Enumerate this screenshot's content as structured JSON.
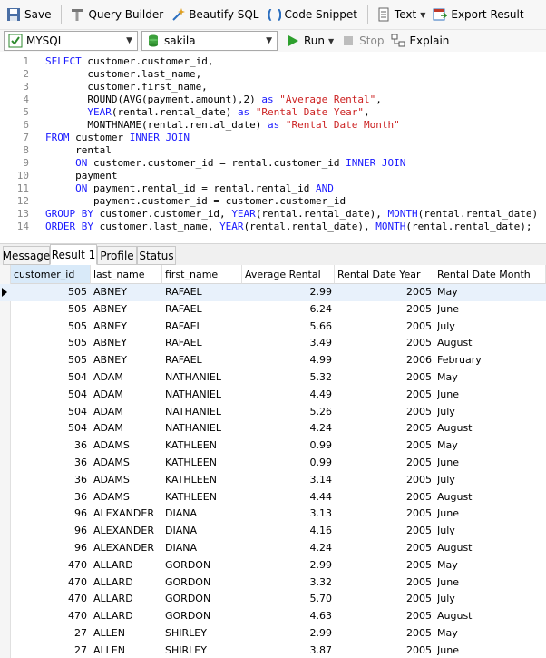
{
  "toolbar": {
    "save": "Save",
    "query_builder": "Query Builder",
    "beautify": "Beautify SQL",
    "code_snippet": "Code Snippet",
    "text": "Text",
    "export": "Export Result",
    "connection": "MYSQL",
    "database": "sakila",
    "run": "Run",
    "stop": "Stop",
    "explain": "Explain"
  },
  "editor": {
    "lines": [
      {
        "n": "1"
      },
      {
        "n": "2"
      },
      {
        "n": "3"
      },
      {
        "n": "4"
      },
      {
        "n": "5"
      },
      {
        "n": "6"
      },
      {
        "n": "7"
      },
      {
        "n": "8"
      },
      {
        "n": "9"
      },
      {
        "n": "10"
      },
      {
        "n": "11"
      },
      {
        "n": "12"
      },
      {
        "n": "13"
      },
      {
        "n": "14"
      }
    ],
    "t": {
      "l1a": "SELECT",
      "l1b": " customer.customer_id,",
      "l2": "       customer.last_name,",
      "l3": "       customer.first_name,",
      "l4a": "       ROUND(AVG(payment.amount),2) ",
      "l4b": "as",
      "l4c": " ",
      "l4d": "\"Average Rental\"",
      "l4e": ",",
      "l5a": "       ",
      "l5b": "YEAR",
      "l5c": "(rental.rental_date) ",
      "l5d": "as",
      "l5e": " ",
      "l5f": "\"Rental Date Year\"",
      "l5g": ",",
      "l6a": "       MONTHNAME(rental.rental_date) ",
      "l6b": "as",
      "l6c": " ",
      "l6d": "\"Rental Date Month\"",
      "l7a": "FROM",
      "l7b": " customer ",
      "l7c": "INNER JOIN",
      "l8": "     rental",
      "l9a": "     ",
      "l9b": "ON",
      "l9c": " customer.customer_id = rental.customer_id ",
      "l9d": "INNER JOIN",
      "l10": "     payment",
      "l11a": "     ",
      "l11b": "ON",
      "l11c": " payment.rental_id = rental.rental_id ",
      "l11d": "AND",
      "l12": "        payment.customer_id = customer.customer_id",
      "l13a": "GROUP BY",
      "l13b": " customer.customer_id, ",
      "l13c": "YEAR",
      "l13d": "(rental.rental_date), ",
      "l13e": "MONTH",
      "l13f": "(rental.rental_date)",
      "l14a": "ORDER BY",
      "l14b": " customer.last_name, ",
      "l14c": "YEAR",
      "l14d": "(rental.rental_date), ",
      "l14e": "MONTH",
      "l14f": "(rental.rental_date);"
    }
  },
  "tabs": [
    "Message",
    "Result 1",
    "Profile",
    "Status"
  ],
  "columns": [
    "customer_id",
    "last_name",
    "first_name",
    "Average Rental",
    "Rental Date Year",
    "Rental Date Month"
  ],
  "rows": [
    [
      "505",
      "ABNEY",
      "RAFAEL",
      "2.99",
      "2005",
      "May"
    ],
    [
      "505",
      "ABNEY",
      "RAFAEL",
      "6.24",
      "2005",
      "June"
    ],
    [
      "505",
      "ABNEY",
      "RAFAEL",
      "5.66",
      "2005",
      "July"
    ],
    [
      "505",
      "ABNEY",
      "RAFAEL",
      "3.49",
      "2005",
      "August"
    ],
    [
      "505",
      "ABNEY",
      "RAFAEL",
      "4.99",
      "2006",
      "February"
    ],
    [
      "504",
      "ADAM",
      "NATHANIEL",
      "5.32",
      "2005",
      "May"
    ],
    [
      "504",
      "ADAM",
      "NATHANIEL",
      "4.49",
      "2005",
      "June"
    ],
    [
      "504",
      "ADAM",
      "NATHANIEL",
      "5.26",
      "2005",
      "July"
    ],
    [
      "504",
      "ADAM",
      "NATHANIEL",
      "4.24",
      "2005",
      "August"
    ],
    [
      "36",
      "ADAMS",
      "KATHLEEN",
      "0.99",
      "2005",
      "May"
    ],
    [
      "36",
      "ADAMS",
      "KATHLEEN",
      "0.99",
      "2005",
      "June"
    ],
    [
      "36",
      "ADAMS",
      "KATHLEEN",
      "3.14",
      "2005",
      "July"
    ],
    [
      "36",
      "ADAMS",
      "KATHLEEN",
      "4.44",
      "2005",
      "August"
    ],
    [
      "96",
      "ALEXANDER",
      "DIANA",
      "3.13",
      "2005",
      "June"
    ],
    [
      "96",
      "ALEXANDER",
      "DIANA",
      "4.16",
      "2005",
      "July"
    ],
    [
      "96",
      "ALEXANDER",
      "DIANA",
      "4.24",
      "2005",
      "August"
    ],
    [
      "470",
      "ALLARD",
      "GORDON",
      "2.99",
      "2005",
      "May"
    ],
    [
      "470",
      "ALLARD",
      "GORDON",
      "3.32",
      "2005",
      "June"
    ],
    [
      "470",
      "ALLARD",
      "GORDON",
      "5.70",
      "2005",
      "July"
    ],
    [
      "470",
      "ALLARD",
      "GORDON",
      "4.63",
      "2005",
      "August"
    ],
    [
      "27",
      "ALLEN",
      "SHIRLEY",
      "2.99",
      "2005",
      "May"
    ],
    [
      "27",
      "ALLEN",
      "SHIRLEY",
      "3.87",
      "2005",
      "June"
    ]
  ]
}
